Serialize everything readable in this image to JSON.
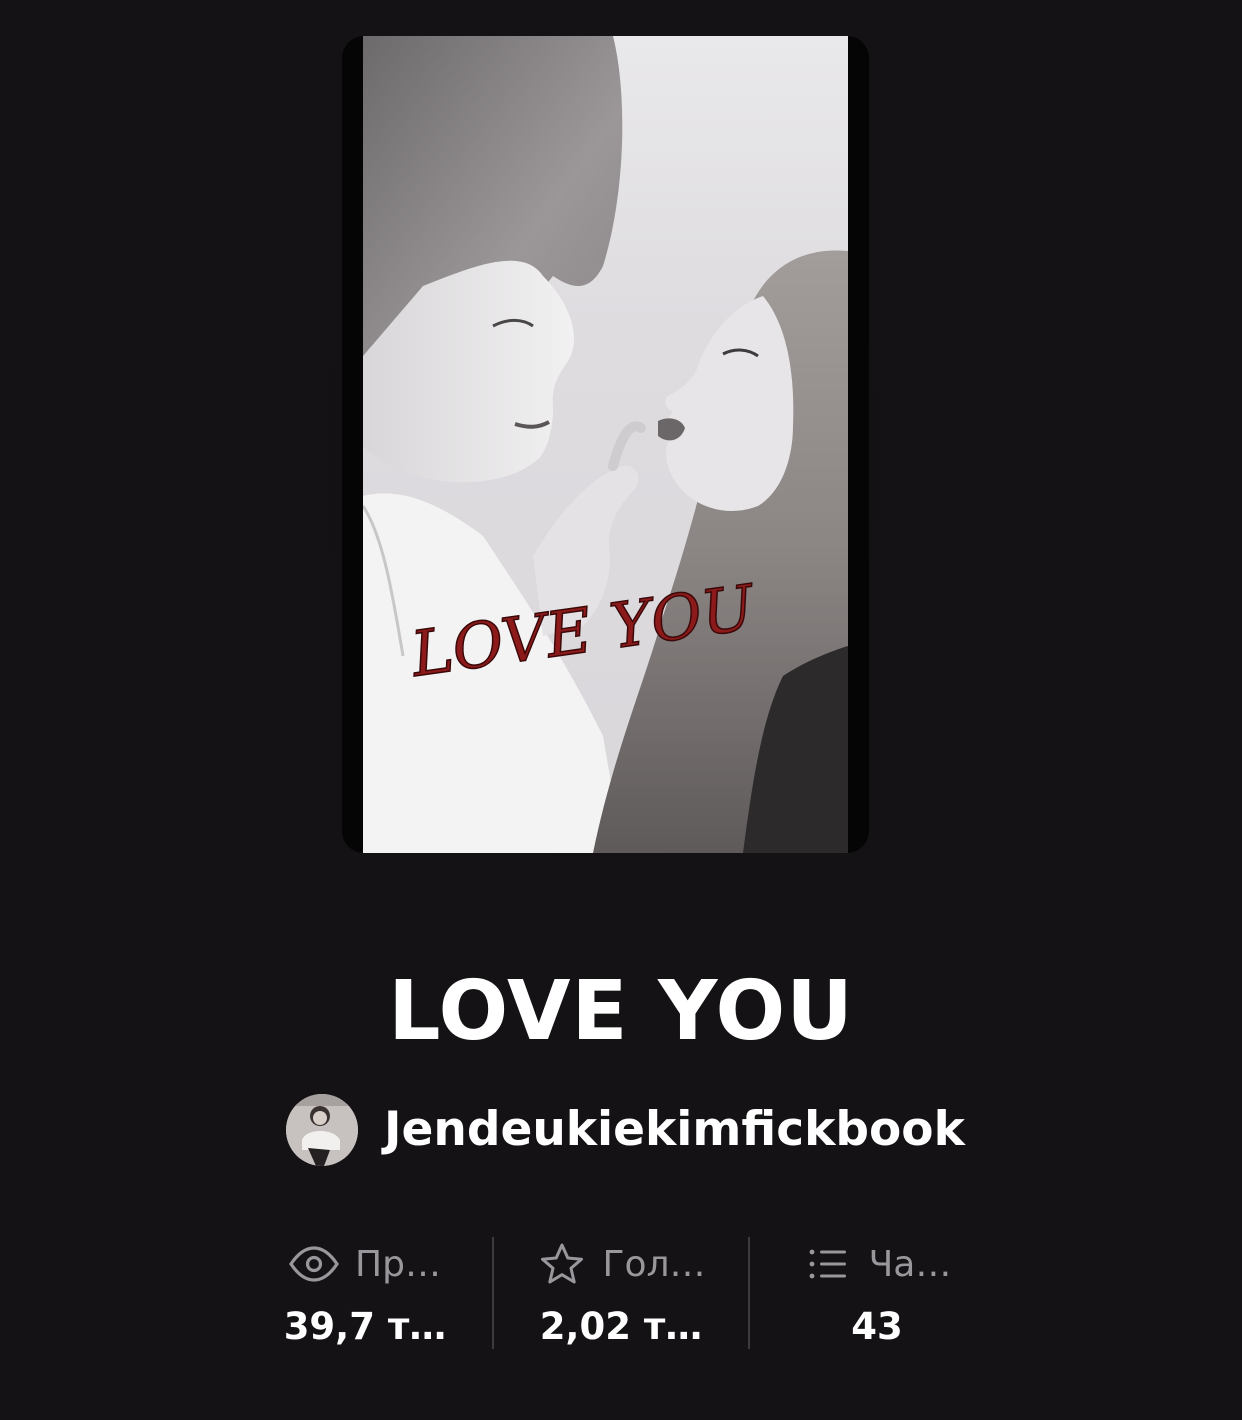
{
  "story": {
    "title": "LOVE YOU",
    "cover_text": "LOVE YOU",
    "author": "Jendeukiekimfickbook"
  },
  "stats": [
    {
      "icon": "eye-icon",
      "label": "Пр…",
      "value": "39,7 т…"
    },
    {
      "icon": "star-icon",
      "label": "Гол…",
      "value": "2,02 т…"
    },
    {
      "icon": "list-icon",
      "label": "Ча…",
      "value": "43"
    }
  ],
  "colors": {
    "background": "#141215",
    "text": "#ffffff",
    "muted": "#9a979c",
    "divider": "#3e3b40",
    "cover_script": "#8c1a1a"
  }
}
